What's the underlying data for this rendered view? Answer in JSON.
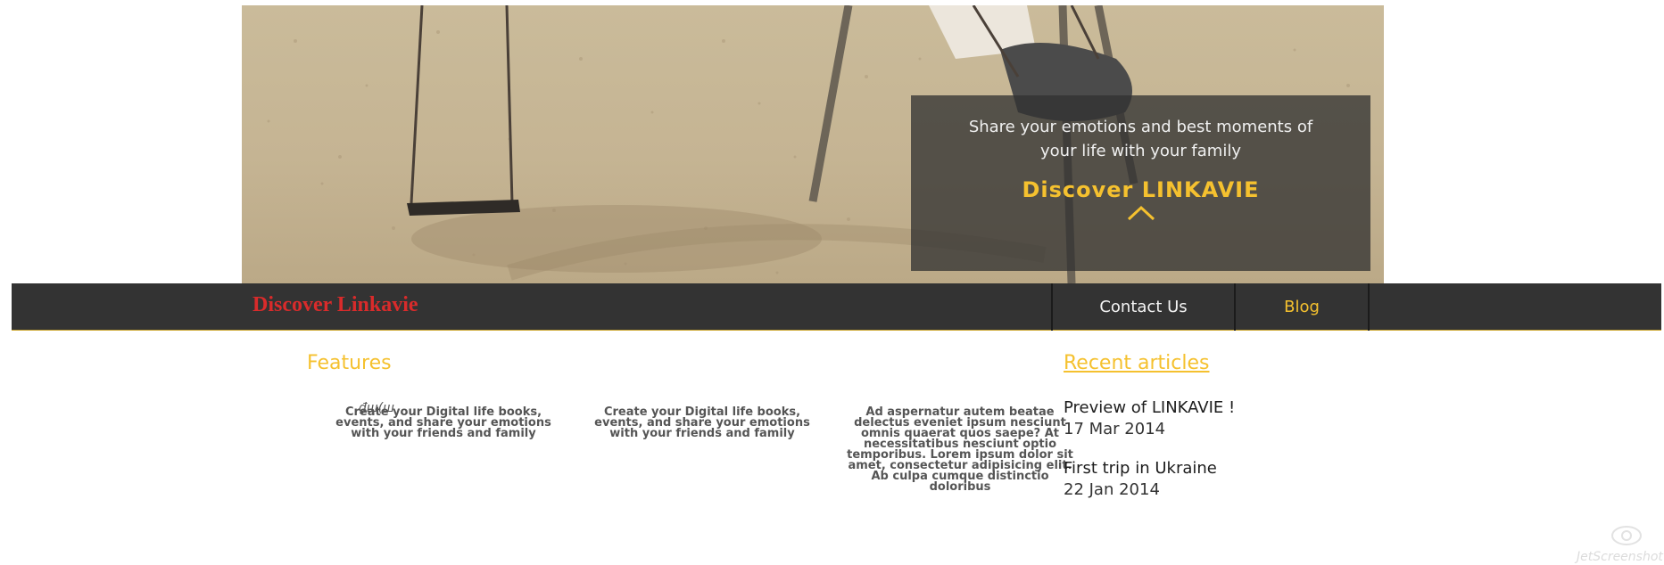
{
  "hero": {
    "image": "playground-swings-on-sand",
    "tagline": "Share your emotions and best moments of your life with your family",
    "cta": "Discover LINKAVIE",
    "chevron_icon": "chevron-up-icon"
  },
  "navbar": {
    "brand": "Discover Linkavie",
    "items": [
      {
        "label": "Contact Us"
      },
      {
        "label": "Blog"
      }
    ]
  },
  "features": {
    "title": "Features",
    "icon_glyph": "₫ш(ш",
    "items": [
      {
        "text": "Create your Digital life books, events, and share your emotions with your friends and family"
      },
      {
        "text": "Create your Digital life books, events, and share your emotions with your friends and family"
      },
      {
        "text": "Ad aspernatur autem beatae delectus eveniet ipsum nesciunt omnis quaerat quos saepe? At necessitatibus nesciunt optio temporibus. Lorem ipsum dolor sit amet, consectetur adipisicing elit. Ab culpa cumque distinctio doloribus"
      }
    ]
  },
  "recent": {
    "title": "Recent articles",
    "articles": [
      {
        "title": "Preview of LINKAVIE !",
        "date": "17 Mar 2014"
      },
      {
        "title": "First trip in Ukraine",
        "date": "22 Jan 2014"
      }
    ]
  },
  "watermark": {
    "text": "JetScreenshot"
  },
  "colors": {
    "accent": "#f5c12f",
    "brand": "#d92b2b",
    "navbar": "#333333"
  }
}
